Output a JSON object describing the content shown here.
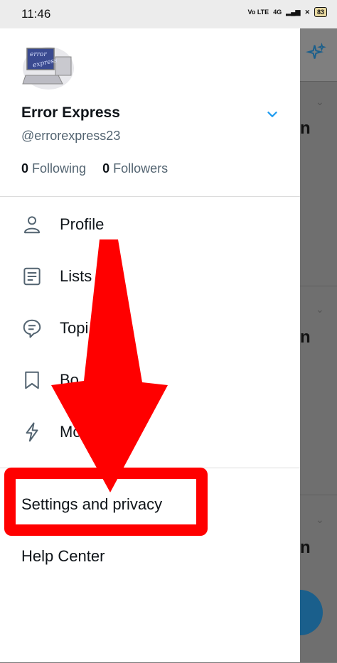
{
  "status_bar": {
    "time": "11:46",
    "network": "4G",
    "volte": "Vo LTE",
    "battery": "83"
  },
  "account": {
    "name": "Error Express",
    "handle": "@errorexpress23",
    "avatar_text_top": "error",
    "avatar_text_bottom": "express"
  },
  "stats": {
    "following_count": "0",
    "following_label": "Following",
    "followers_count": "0",
    "followers_label": "Followers"
  },
  "menu": [
    {
      "label": "Profile",
      "icon": "person-icon"
    },
    {
      "label": "Lists",
      "icon": "list-icon"
    },
    {
      "label": "Topi",
      "icon": "topics-icon"
    },
    {
      "label": "Bo",
      "icon": "bookmark-icon"
    },
    {
      "label": "Mo",
      "icon": "bolt-icon"
    }
  ],
  "settings": {
    "label": "Settings and privacy"
  },
  "help": {
    "label": "Help Center"
  },
  "backdrop": {
    "letter": "n"
  },
  "colors": {
    "accent": "#1d9bf0",
    "annotation_red": "#ff0000"
  }
}
